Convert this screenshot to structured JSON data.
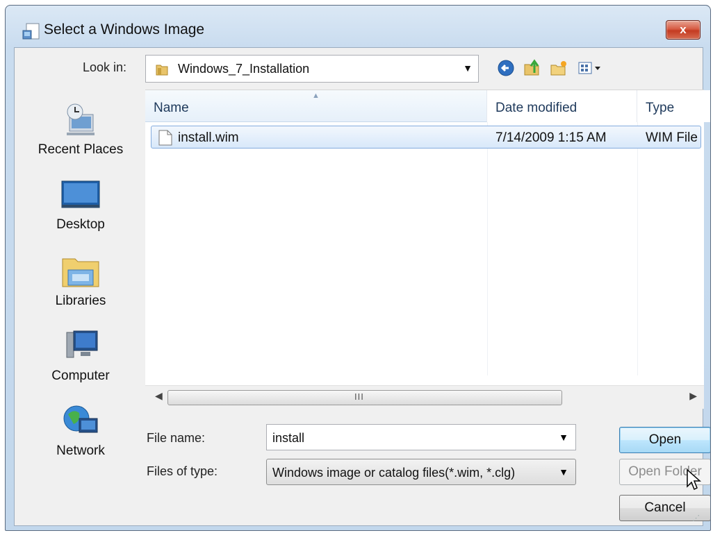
{
  "window": {
    "title": "Select a Windows Image",
    "close_label": "x"
  },
  "lookin": {
    "label": "Look in:",
    "value": "Windows_7_Installation"
  },
  "toolbar": {
    "icons": [
      "back-icon",
      "up-folder-icon",
      "new-folder-icon",
      "view-menu-icon"
    ]
  },
  "places": [
    {
      "label": "Recent Places",
      "icon": "recent-places-icon"
    },
    {
      "label": "Desktop",
      "icon": "desktop-icon"
    },
    {
      "label": "Libraries",
      "icon": "libraries-icon"
    },
    {
      "label": "Computer",
      "icon": "computer-icon"
    },
    {
      "label": "Network",
      "icon": "network-icon"
    }
  ],
  "filelist": {
    "columns": [
      "Name",
      "Date modified",
      "Type"
    ],
    "rows": [
      {
        "name": "install.wim",
        "date": "7/14/2009 1:15 AM",
        "type": "WIM File"
      }
    ],
    "scroll_grip": "III"
  },
  "form": {
    "filename_label": "File name:",
    "filename_value": "install",
    "filetype_label": "Files of type:",
    "filetype_value": "Windows image or catalog files(*.wim, *.clg)"
  },
  "buttons": {
    "open": "Open",
    "open_folder": "Open Folder",
    "cancel": "Cancel"
  },
  "colors": {
    "title_gradient": "#c9dcef",
    "selection": "#d8e8fa",
    "close_button": "#c43b22"
  }
}
